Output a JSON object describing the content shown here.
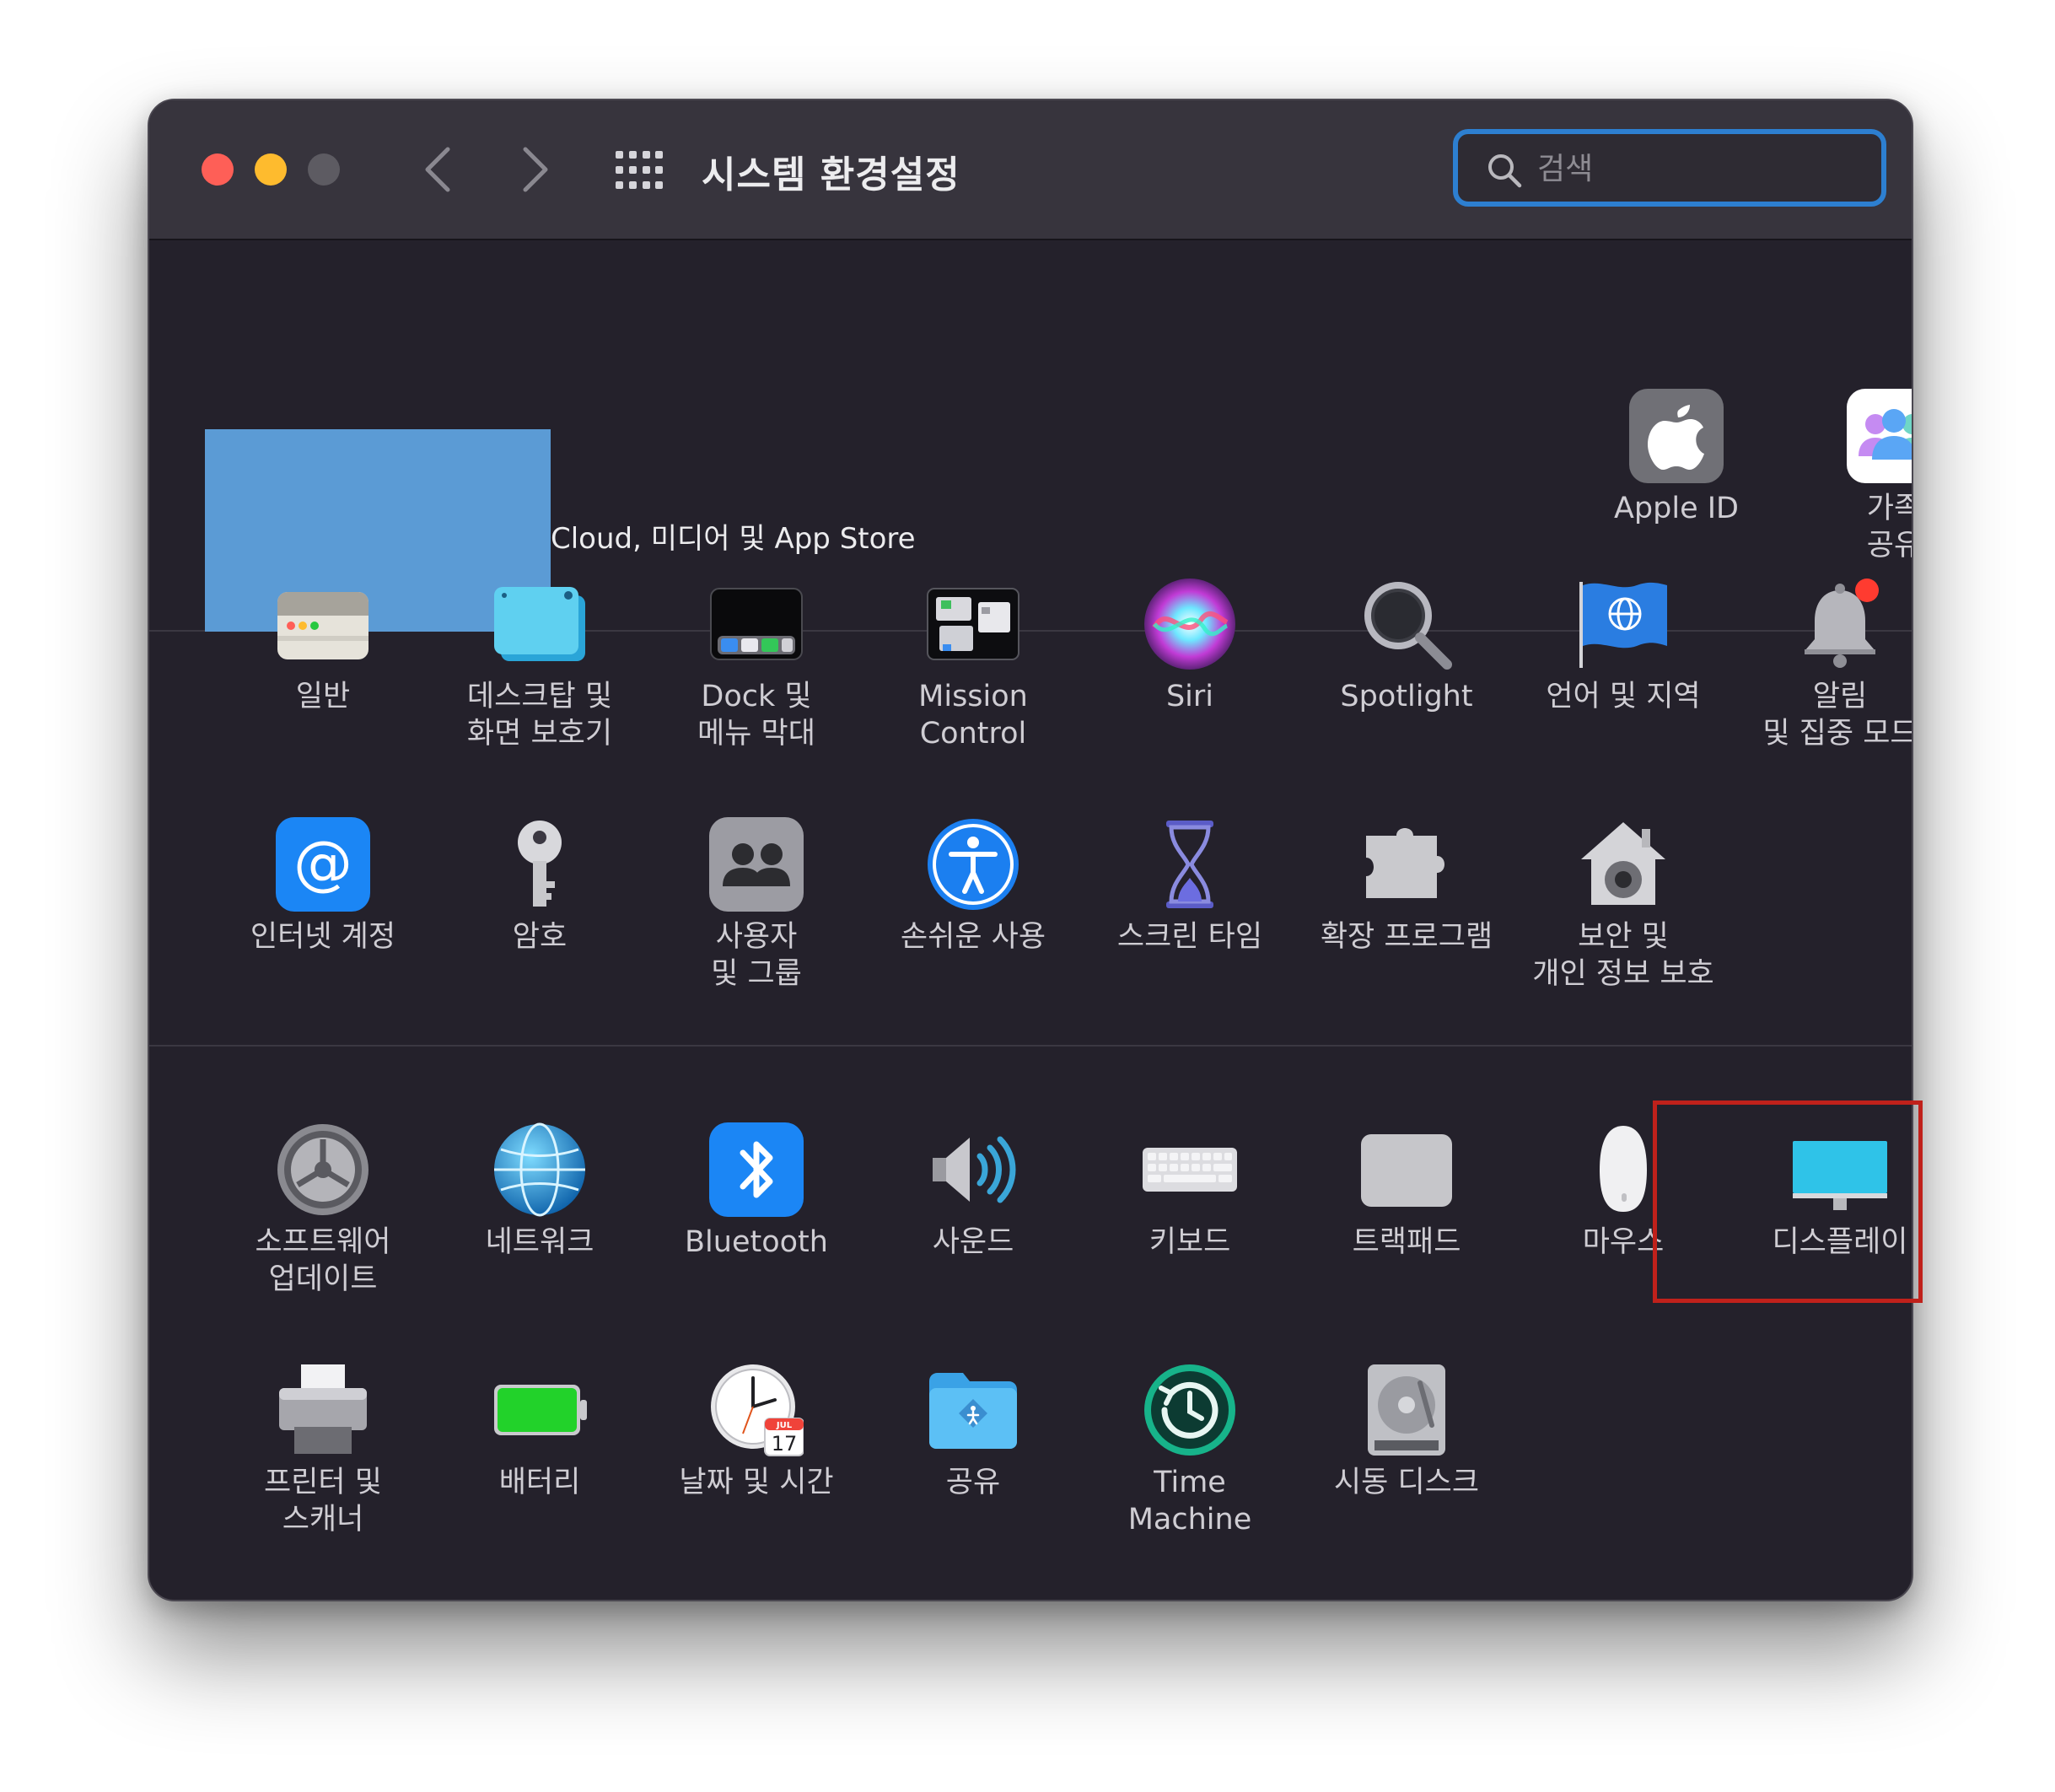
{
  "window": {
    "title": "시스템 환경설정",
    "search_placeholder": "검색"
  },
  "account": {
    "text": "Cloud, 미디어 및 App Store",
    "apple_id_label": "Apple ID",
    "family_label": "가족\n공유"
  },
  "rows": {
    "personal": [
      {
        "label": "일반",
        "icon": "general-icon"
      },
      {
        "label": "데스크탑 및\n화면 보호기",
        "icon": "desktop-screensaver-icon"
      },
      {
        "label": "Dock 및\n메뉴 막대",
        "icon": "dock-icon"
      },
      {
        "label": "Mission\nControl",
        "icon": "mission-control-icon"
      },
      {
        "label": "Siri",
        "icon": "siri-icon"
      },
      {
        "label": "Spotlight",
        "icon": "spotlight-icon"
      },
      {
        "label": "언어 및 지역",
        "icon": "language-region-icon"
      },
      {
        "label": "알림\n및 집중 모드",
        "icon": "notifications-icon"
      },
      {
        "label": "인터넷 계정",
        "icon": "internet-accounts-icon"
      },
      {
        "label": "암호",
        "icon": "passwords-icon"
      },
      {
        "label": "사용자\n및 그룹",
        "icon": "users-groups-icon"
      },
      {
        "label": "손쉬운 사용",
        "icon": "accessibility-icon"
      },
      {
        "label": "스크린 타임",
        "icon": "screen-time-icon"
      },
      {
        "label": "확장 프로그램",
        "icon": "extensions-icon"
      },
      {
        "label": "보안 및\n개인 정보 보호",
        "icon": "security-privacy-icon"
      }
    ],
    "hardware": [
      {
        "label": "소프트웨어\n업데이트",
        "icon": "software-update-icon"
      },
      {
        "label": "네트워크",
        "icon": "network-icon"
      },
      {
        "label": "Bluetooth",
        "icon": "bluetooth-icon"
      },
      {
        "label": "사운드",
        "icon": "sound-icon"
      },
      {
        "label": "키보드",
        "icon": "keyboard-icon"
      },
      {
        "label": "트랙패드",
        "icon": "trackpad-icon"
      },
      {
        "label": "마우스",
        "icon": "mouse-icon"
      },
      {
        "label": "디스플레이",
        "icon": "display-icon"
      },
      {
        "label": "프린터 및\n스캐너",
        "icon": "printers-scanners-icon"
      },
      {
        "label": "배터리",
        "icon": "battery-icon"
      },
      {
        "label": "날짜 및 시간",
        "icon": "date-time-icon"
      },
      {
        "label": "공유",
        "icon": "sharing-icon"
      },
      {
        "label": "Time\nMachine",
        "icon": "time-machine-icon"
      },
      {
        "label": "시동 디스크",
        "icon": "startup-disk-icon"
      }
    ]
  },
  "calendar": {
    "month": "JUL",
    "day": "17"
  },
  "colors": {
    "window_bg": "#24212b",
    "titlebar_bg": "#37343d",
    "search_focus": "#2d7fd0",
    "highlight": "#c0211b",
    "account_placeholder": "#5b9bd5"
  }
}
